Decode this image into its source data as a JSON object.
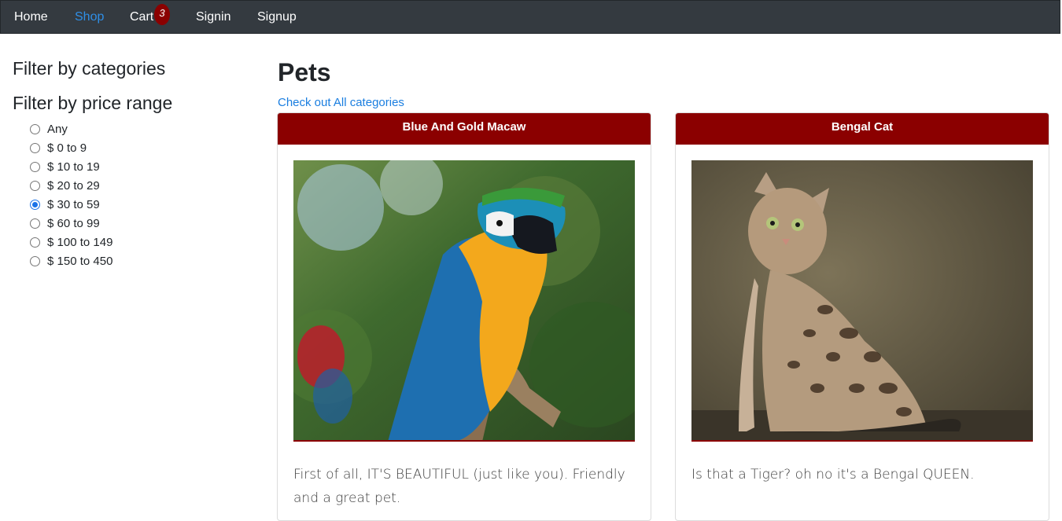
{
  "navbar": {
    "items": [
      {
        "label": "Home"
      },
      {
        "label": "Shop"
      },
      {
        "label": "Cart"
      },
      {
        "label": "Signin"
      },
      {
        "label": "Signup"
      }
    ],
    "cart_count": "3",
    "active": "Shop"
  },
  "sidebar": {
    "categories_heading": "Filter by categories",
    "price_heading": "Filter by price range",
    "price_options": [
      {
        "label": "Any",
        "checked": false
      },
      {
        "label": "$ 0 to 9",
        "checked": false
      },
      {
        "label": "$ 10 to 19",
        "checked": false
      },
      {
        "label": "$ 20 to 29",
        "checked": false
      },
      {
        "label": "$ 30 to 59",
        "checked": true
      },
      {
        "label": "$ 60 to 99",
        "checked": false
      },
      {
        "label": "$ 100 to 149",
        "checked": false
      },
      {
        "label": "$ 150 to 450",
        "checked": false
      }
    ]
  },
  "main": {
    "title": "Pets",
    "category_link": "Check out All categories",
    "products": [
      {
        "name": "Blue And Gold Macaw",
        "description": "First of all, IT'S BEAUTIFUL (just like you). Friendly and a great pet.",
        "image": "macaw-photo"
      },
      {
        "name": "Bengal Cat",
        "description": "Is that a Tiger? oh no it's a Bengal QUEEN.",
        "image": "bengal-cat-photo"
      }
    ]
  },
  "colors": {
    "navbar_bg": "#343a40",
    "accent_red": "#8b0000",
    "link_blue": "#1a7ee0",
    "active_nav": "#2f8fe6"
  }
}
